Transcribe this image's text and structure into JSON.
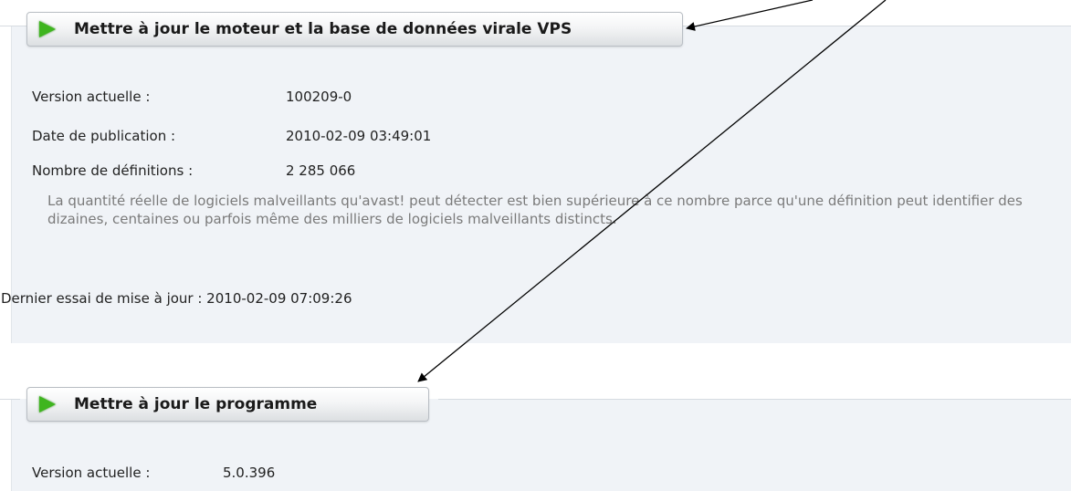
{
  "vps_section": {
    "button_label": "Mettre à jour le moteur et la base de données virale VPS",
    "version_label": "Version actuelle :",
    "version_value": "100209-0",
    "date_label": "Date de publication :",
    "date_value": "2010-02-09 03:49:01",
    "definitions_label": "Nombre de définitions :",
    "definitions_value": "2 285 066",
    "note": "La quantité réelle de logiciels malveillants qu'avast! peut détecter est bien supérieure à ce nombre parce qu'une définition peut identifier des dizaines, centaines ou parfois même des milliers de logiciels malveillants distincts.",
    "last_try": "Dernier essai de mise à jour : 2010-02-09 07:09:26"
  },
  "program_section": {
    "button_label": "Mettre à jour le programme",
    "version_label": "Version actuelle :",
    "version_value": "5.0.396"
  },
  "icons": {
    "button_icon": "play-arrow-icon",
    "button_icon_color": "#3fb51f"
  }
}
